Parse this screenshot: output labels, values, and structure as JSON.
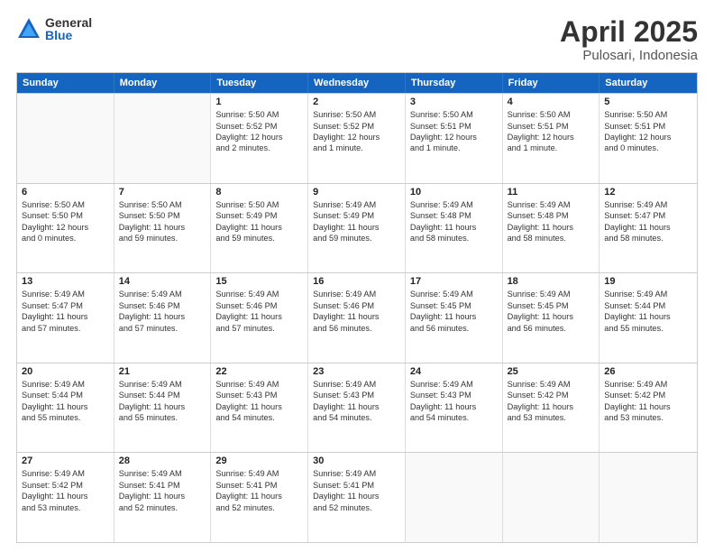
{
  "header": {
    "logo_general": "General",
    "logo_blue": "Blue",
    "title": "April 2025",
    "subtitle": "Pulosari, Indonesia"
  },
  "days_of_week": [
    "Sunday",
    "Monday",
    "Tuesday",
    "Wednesday",
    "Thursday",
    "Friday",
    "Saturday"
  ],
  "weeks": [
    [
      {
        "day": "",
        "lines": []
      },
      {
        "day": "",
        "lines": []
      },
      {
        "day": "1",
        "lines": [
          "Sunrise: 5:50 AM",
          "Sunset: 5:52 PM",
          "Daylight: 12 hours",
          "and 2 minutes."
        ]
      },
      {
        "day": "2",
        "lines": [
          "Sunrise: 5:50 AM",
          "Sunset: 5:52 PM",
          "Daylight: 12 hours",
          "and 1 minute."
        ]
      },
      {
        "day": "3",
        "lines": [
          "Sunrise: 5:50 AM",
          "Sunset: 5:51 PM",
          "Daylight: 12 hours",
          "and 1 minute."
        ]
      },
      {
        "day": "4",
        "lines": [
          "Sunrise: 5:50 AM",
          "Sunset: 5:51 PM",
          "Daylight: 12 hours",
          "and 1 minute."
        ]
      },
      {
        "day": "5",
        "lines": [
          "Sunrise: 5:50 AM",
          "Sunset: 5:51 PM",
          "Daylight: 12 hours",
          "and 0 minutes."
        ]
      }
    ],
    [
      {
        "day": "6",
        "lines": [
          "Sunrise: 5:50 AM",
          "Sunset: 5:50 PM",
          "Daylight: 12 hours",
          "and 0 minutes."
        ]
      },
      {
        "day": "7",
        "lines": [
          "Sunrise: 5:50 AM",
          "Sunset: 5:50 PM",
          "Daylight: 11 hours",
          "and 59 minutes."
        ]
      },
      {
        "day": "8",
        "lines": [
          "Sunrise: 5:50 AM",
          "Sunset: 5:49 PM",
          "Daylight: 11 hours",
          "and 59 minutes."
        ]
      },
      {
        "day": "9",
        "lines": [
          "Sunrise: 5:49 AM",
          "Sunset: 5:49 PM",
          "Daylight: 11 hours",
          "and 59 minutes."
        ]
      },
      {
        "day": "10",
        "lines": [
          "Sunrise: 5:49 AM",
          "Sunset: 5:48 PM",
          "Daylight: 11 hours",
          "and 58 minutes."
        ]
      },
      {
        "day": "11",
        "lines": [
          "Sunrise: 5:49 AM",
          "Sunset: 5:48 PM",
          "Daylight: 11 hours",
          "and 58 minutes."
        ]
      },
      {
        "day": "12",
        "lines": [
          "Sunrise: 5:49 AM",
          "Sunset: 5:47 PM",
          "Daylight: 11 hours",
          "and 58 minutes."
        ]
      }
    ],
    [
      {
        "day": "13",
        "lines": [
          "Sunrise: 5:49 AM",
          "Sunset: 5:47 PM",
          "Daylight: 11 hours",
          "and 57 minutes."
        ]
      },
      {
        "day": "14",
        "lines": [
          "Sunrise: 5:49 AM",
          "Sunset: 5:46 PM",
          "Daylight: 11 hours",
          "and 57 minutes."
        ]
      },
      {
        "day": "15",
        "lines": [
          "Sunrise: 5:49 AM",
          "Sunset: 5:46 PM",
          "Daylight: 11 hours",
          "and 57 minutes."
        ]
      },
      {
        "day": "16",
        "lines": [
          "Sunrise: 5:49 AM",
          "Sunset: 5:46 PM",
          "Daylight: 11 hours",
          "and 56 minutes."
        ]
      },
      {
        "day": "17",
        "lines": [
          "Sunrise: 5:49 AM",
          "Sunset: 5:45 PM",
          "Daylight: 11 hours",
          "and 56 minutes."
        ]
      },
      {
        "day": "18",
        "lines": [
          "Sunrise: 5:49 AM",
          "Sunset: 5:45 PM",
          "Daylight: 11 hours",
          "and 56 minutes."
        ]
      },
      {
        "day": "19",
        "lines": [
          "Sunrise: 5:49 AM",
          "Sunset: 5:44 PM",
          "Daylight: 11 hours",
          "and 55 minutes."
        ]
      }
    ],
    [
      {
        "day": "20",
        "lines": [
          "Sunrise: 5:49 AM",
          "Sunset: 5:44 PM",
          "Daylight: 11 hours",
          "and 55 minutes."
        ]
      },
      {
        "day": "21",
        "lines": [
          "Sunrise: 5:49 AM",
          "Sunset: 5:44 PM",
          "Daylight: 11 hours",
          "and 55 minutes."
        ]
      },
      {
        "day": "22",
        "lines": [
          "Sunrise: 5:49 AM",
          "Sunset: 5:43 PM",
          "Daylight: 11 hours",
          "and 54 minutes."
        ]
      },
      {
        "day": "23",
        "lines": [
          "Sunrise: 5:49 AM",
          "Sunset: 5:43 PM",
          "Daylight: 11 hours",
          "and 54 minutes."
        ]
      },
      {
        "day": "24",
        "lines": [
          "Sunrise: 5:49 AM",
          "Sunset: 5:43 PM",
          "Daylight: 11 hours",
          "and 54 minutes."
        ]
      },
      {
        "day": "25",
        "lines": [
          "Sunrise: 5:49 AM",
          "Sunset: 5:42 PM",
          "Daylight: 11 hours",
          "and 53 minutes."
        ]
      },
      {
        "day": "26",
        "lines": [
          "Sunrise: 5:49 AM",
          "Sunset: 5:42 PM",
          "Daylight: 11 hours",
          "and 53 minutes."
        ]
      }
    ],
    [
      {
        "day": "27",
        "lines": [
          "Sunrise: 5:49 AM",
          "Sunset: 5:42 PM",
          "Daylight: 11 hours",
          "and 53 minutes."
        ]
      },
      {
        "day": "28",
        "lines": [
          "Sunrise: 5:49 AM",
          "Sunset: 5:41 PM",
          "Daylight: 11 hours",
          "and 52 minutes."
        ]
      },
      {
        "day": "29",
        "lines": [
          "Sunrise: 5:49 AM",
          "Sunset: 5:41 PM",
          "Daylight: 11 hours",
          "and 52 minutes."
        ]
      },
      {
        "day": "30",
        "lines": [
          "Sunrise: 5:49 AM",
          "Sunset: 5:41 PM",
          "Daylight: 11 hours",
          "and 52 minutes."
        ]
      },
      {
        "day": "",
        "lines": []
      },
      {
        "day": "",
        "lines": []
      },
      {
        "day": "",
        "lines": []
      }
    ]
  ]
}
